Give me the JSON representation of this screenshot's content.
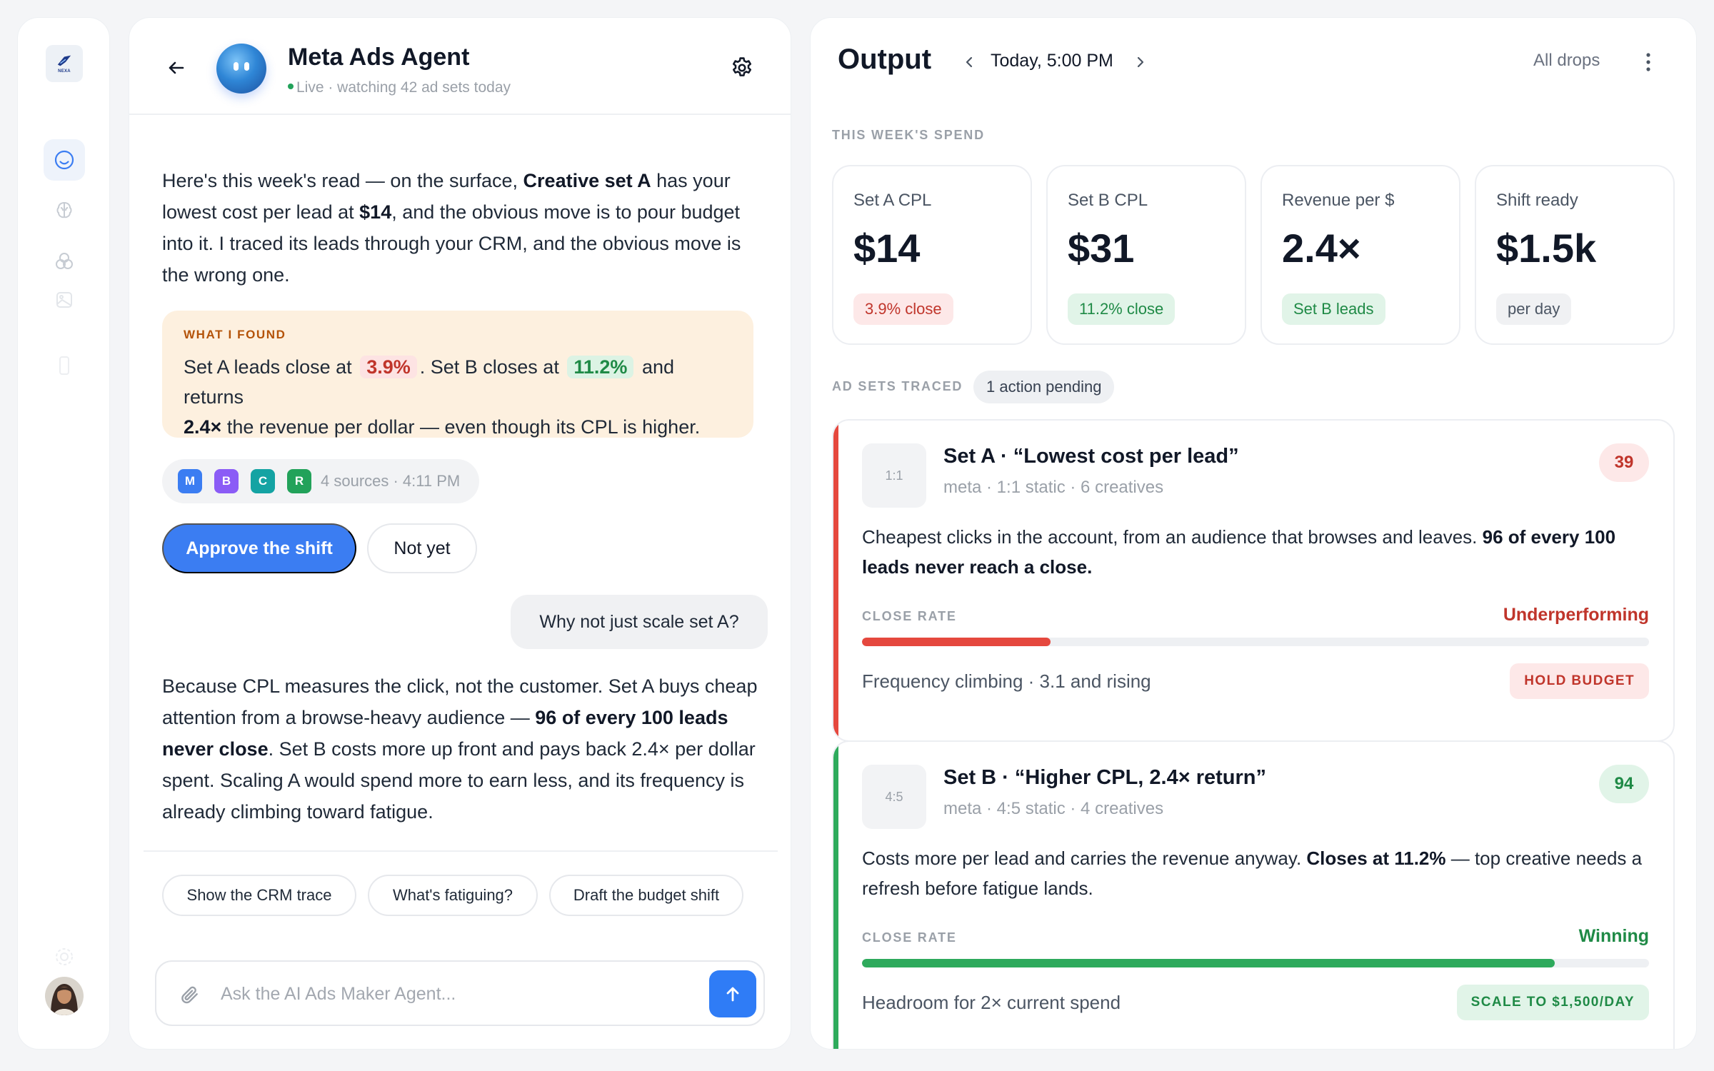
{
  "rail": {
    "logo_text": "NEXA",
    "colors": {
      "active": "#3b7df2",
      "muted": "#c7ccd3"
    },
    "items": [
      {
        "icon": "smiley-icon",
        "active": true
      },
      {
        "icon": "brain-icon",
        "active": false
      },
      {
        "icon": "circles-icon",
        "active": false
      },
      {
        "icon": "image-icon",
        "active": false
      },
      {
        "icon": "phone-icon",
        "active": false
      },
      {
        "icon": "gear-icon",
        "active": false
      }
    ]
  },
  "chat": {
    "agent_name": "Meta Ads Agent",
    "agent_status": "Live · watching 42 ad sets today",
    "message1": {
      "t1": "Here's this week's read — on the surface, ",
      "b1": "Creative set A",
      "t2": " has your lowest cost per lead at ",
      "b2": "$14",
      "t3": ", and the obvious move is to pour budget into it. I traced its leads through your CRM, and the obvious move is the wrong one."
    },
    "found": {
      "label": "WHAT I FOUND",
      "t1": "Set A leads close at",
      "v1": "3.9%",
      "t2": ". Set B closes at",
      "v2": "11.2%",
      "t3": "and returns",
      "b1": "2.4×",
      "t4": " the revenue per dollar — even though its CPL is higher."
    },
    "sources": {
      "badges": [
        {
          "letter": "M",
          "color": "#3b7df2"
        },
        {
          "letter": "B",
          "color": "#8b5cf6"
        },
        {
          "letter": "C",
          "color": "#14a3a3"
        },
        {
          "letter": "R",
          "color": "#22a25a"
        }
      ],
      "text": "4 sources · 4:11 PM"
    },
    "approve_label": "Approve the shift",
    "notyet_label": "Not yet",
    "user_message": "Why not just scale set A?",
    "message2": {
      "t1": "Because CPL measures the click, not the customer. Set A buys cheap attention from a browse-heavy audience — ",
      "b1": "96 of every 100 leads never close",
      "t2": ". Set B costs more up front and pays back 2.4× per dollar spent. Scaling A would spend more to earn less, and its frequency is already climbing toward fatigue."
    },
    "chips": [
      "Show the CRM trace",
      "What's fatiguing?",
      "Draft the budget shift"
    ],
    "composer_placeholder": "Ask the AI Ads Maker Agent..."
  },
  "output": {
    "title": "Output",
    "date": "Today, 5:00 PM",
    "all_drops": "All drops",
    "spend_label": "THIS WEEK'S SPEND",
    "stats": [
      {
        "label": "Set A CPL",
        "value": "$14",
        "badge": "3.9% close",
        "tone": "red"
      },
      {
        "label": "Set B CPL",
        "value": "$31",
        "badge": "11.2% close",
        "tone": "green"
      },
      {
        "label": "Revenue per $",
        "value": "2.4×",
        "badge": "Set B leads",
        "tone": "green"
      },
      {
        "label": "Shift ready",
        "value": "$1.5k",
        "badge": "per day",
        "tone": "gray"
      }
    ],
    "adsets_label": "AD SETS TRACED",
    "pending": "1 action pending",
    "adsets": [
      {
        "ratio": "1:1",
        "title": "Set A · “Lowest cost per lead”",
        "meta": "meta · 1:1 static · 6 creatives",
        "score": "39",
        "desc_t1": "Cheapest clicks in the account, from an audience that browses and leaves. ",
        "desc_b1": "96 of every 100 leads never reach a close.",
        "desc_t2": "",
        "close_label": "CLOSE RATE",
        "close_status": "Underperforming",
        "close_pct": 24,
        "footer": "Frequency climbing · 3.1 and rising",
        "action": "HOLD BUDGET",
        "colors": {
          "accent": "#e5483e",
          "status": "#c0352b",
          "score_bg": "#fde8e8",
          "tag_bg": "#fde8e8"
        }
      },
      {
        "ratio": "4:5",
        "title": "Set B · “Higher CPL, 2.4× return”",
        "meta": "meta · 4:5 static · 4 creatives",
        "score": "94",
        "desc_t1": "Costs more per lead and carries the revenue anyway. ",
        "desc_b1": "Closes at 11.2%",
        "desc_t2": " — top creative needs a refresh before fatigue lands.",
        "close_label": "CLOSE RATE",
        "close_status": "Winning",
        "close_pct": 88,
        "footer": "Headroom for 2× current spend",
        "action": "SCALE TO $1,500/DAY",
        "colors": {
          "accent": "#2eaa5c",
          "status": "#1f8a46",
          "score_bg": "#e1f4e8",
          "tag_bg": "#e1f4e8"
        }
      }
    ]
  }
}
